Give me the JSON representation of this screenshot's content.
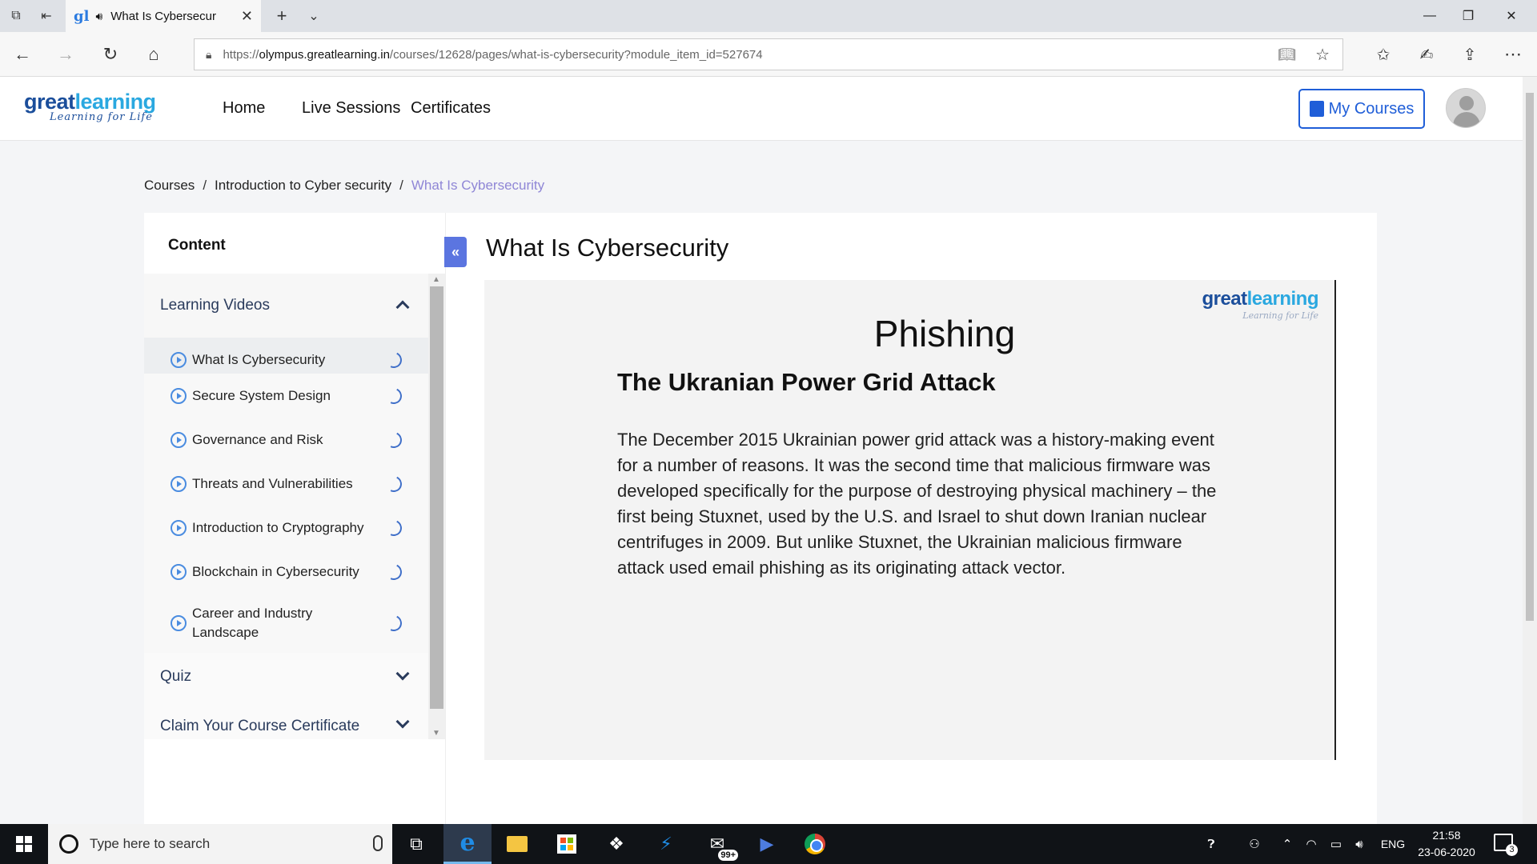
{
  "browser": {
    "tab_title": "What Is Cybersecur",
    "tab_favicon": "gl",
    "url_prefix": "https://",
    "url_host": "olympus.greatlearning.in",
    "url_path": "/courses/12628/pages/what-is-cybersecurity?module_item_id=527674"
  },
  "site": {
    "logo_main_1": "great",
    "logo_main_2": "learning",
    "logo_tagline": "Learning for Life",
    "nav": [
      "Home",
      "Live Sessions",
      "Certificates"
    ],
    "my_courses": "My Courses"
  },
  "breadcrumb": [
    "Courses",
    "Introduction to Cyber security",
    "What Is Cybersecurity"
  ],
  "sidebar": {
    "heading": "Content",
    "sections": [
      {
        "title": "Learning Videos",
        "expanded": true
      },
      {
        "title": "Quiz",
        "expanded": false
      },
      {
        "title": "Claim Your Course Certificate",
        "expanded": false
      }
    ],
    "items": [
      "What Is Cybersecurity",
      "Secure System Design",
      "Governance and Risk",
      "Threats and Vulnerabilities",
      "Introduction to Cryptography",
      "Blockchain in Cybersecurity",
      "Career and Industry Landscape"
    ],
    "item_line2": "Landscape",
    "item_line1": "Career and Industry"
  },
  "main": {
    "title": "What Is Cybersecurity",
    "slide": {
      "logo_1": "great",
      "logo_2": "learning",
      "logo_tagline": "Learning for Life",
      "title": "Phishing",
      "subtitle": "The Ukranian Power Grid Attack",
      "body": "The December 2015 Ukrainian power grid attack was a history-making event for a number of reasons. It was the second time that malicious firmware was developed specifically for the purpose of destroying physical machinery – the first being Stuxnet, used by the U.S. and Israel to shut down Iranian nuclear centrifuges in 2009. But unlike Stuxnet, the Ukrainian malicious firmware attack used email phishing as its originating attack vector."
    }
  },
  "taskbar": {
    "search_placeholder": "Type here to search",
    "mail_badge": "99+",
    "language": "ENG",
    "time": "21:58",
    "date": "23-06-2020",
    "notifications": "3"
  },
  "colors": {
    "accent": "#1f5ed8",
    "breadcrumb_current": "#8f86d6",
    "collapse_button": "#5b75e0"
  }
}
